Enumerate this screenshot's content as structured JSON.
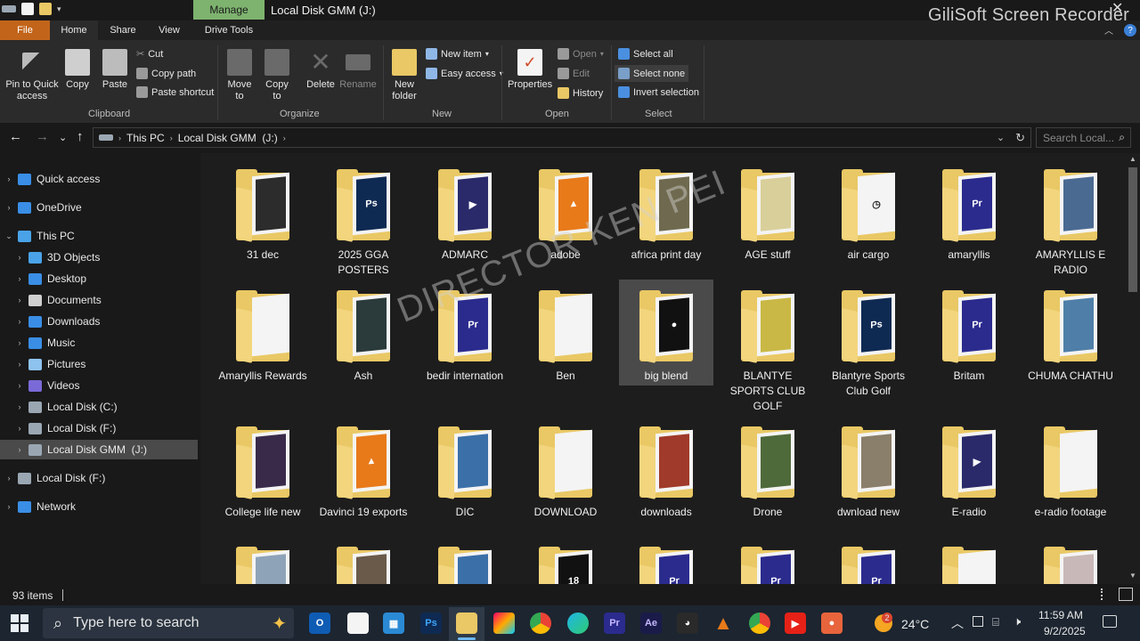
{
  "window": {
    "title": "Local Disk GMM  (J:)",
    "manage_label": "Manage",
    "recorder_watermark": "GiliSoft Screen Recorder"
  },
  "menu_tabs": [
    "File",
    "Home",
    "Share",
    "View",
    "Drive Tools"
  ],
  "ribbon": {
    "clipboard": {
      "pin_label": "Pin to Quick access",
      "copy_label": "Copy",
      "paste_label": "Paste",
      "cut_label": "Cut",
      "copy_path_label": "Copy path",
      "paste_shortcut_label": "Paste shortcut",
      "group_label": "Clipboard"
    },
    "organize": {
      "move_label": "Move to",
      "copy_to_label": "Copy to",
      "delete_label": "Delete",
      "rename_label": "Rename",
      "group_label": "Organize"
    },
    "new": {
      "new_folder_label": "New folder",
      "new_item_label": "New item",
      "easy_access_label": "Easy access",
      "group_label": "New"
    },
    "open": {
      "properties_label": "Properties",
      "open_label": "Open",
      "edit_label": "Edit",
      "history_label": "History",
      "group_label": "Open"
    },
    "select": {
      "select_all_label": "Select all",
      "select_none_label": "Select none",
      "invert_label": "Invert selection",
      "group_label": "Select"
    }
  },
  "address": {
    "crumbs": [
      "This PC",
      "Local Disk GMM  (J:)"
    ],
    "search_placeholder": "Search Local..."
  },
  "nav": [
    {
      "label": "Quick access",
      "icon": "star-icon",
      "color": "#3a8ee6"
    },
    {
      "label": "OneDrive",
      "icon": "cloud-icon",
      "color": "#3a8ee6"
    },
    {
      "label": "This PC",
      "icon": "computer-icon",
      "color": "#4aa3e8"
    },
    {
      "label": "3D Objects",
      "icon": "cube-icon",
      "color": "#4aa3e8"
    },
    {
      "label": "Desktop",
      "icon": "desktop-icon",
      "color": "#3a8ee6"
    },
    {
      "label": "Documents",
      "icon": "document-icon",
      "color": "#cfcfcf"
    },
    {
      "label": "Downloads",
      "icon": "download-icon",
      "color": "#3a8ee6"
    },
    {
      "label": "Music",
      "icon": "music-icon",
      "color": "#3a8ee6"
    },
    {
      "label": "Pictures",
      "icon": "picture-icon",
      "color": "#8fc3ef"
    },
    {
      "label": "Videos",
      "icon": "video-icon",
      "color": "#7a6ad8"
    },
    {
      "label": "Local Disk (C:)",
      "icon": "drive-icon",
      "color": "#9aa7b3"
    },
    {
      "label": "Local Disk (F:)",
      "icon": "drive-icon",
      "color": "#9aa7b3"
    },
    {
      "label": "Local Disk GMM  (J:)",
      "icon": "drive-icon",
      "color": "#9aa7b3"
    },
    {
      "label": "Local Disk (F:)",
      "icon": "drive-icon",
      "color": "#9aa7b3"
    },
    {
      "label": "Network",
      "icon": "network-icon",
      "color": "#3a8ee6"
    }
  ],
  "folders": [
    {
      "label": "31 dec",
      "thumb": "#2c2c2c",
      "text": ""
    },
    {
      "label": "2025 GGA POSTERS",
      "thumb": "#0f2a52",
      "text": "Ps"
    },
    {
      "label": "ADMARC",
      "thumb": "#2a2a6a",
      "text": "▶"
    },
    {
      "label": "adobe",
      "thumb": "#e87a1a",
      "text": "▲"
    },
    {
      "label": "africa print day",
      "thumb": "#6f6a4f",
      "text": ""
    },
    {
      "label": "AGE stuff",
      "thumb": "#d9cf9a",
      "text": ""
    },
    {
      "label": "air cargo",
      "thumb": "#f4f4f4",
      "text": "◷"
    },
    {
      "label": "amaryllis",
      "thumb": "#2b2b8e",
      "text": "Pr"
    },
    {
      "label": "AMARYLLIS E RADIO",
      "thumb": "#4a6a92",
      "text": ""
    },
    {
      "label": "Amaryllis Rewards",
      "thumb": "#f4f4f4",
      "text": ""
    },
    {
      "label": "Ash",
      "thumb": "#2b3b3b",
      "text": ""
    },
    {
      "label": "bedir internation",
      "thumb": "#2b2b8e",
      "text": "Pr"
    },
    {
      "label": "Ben",
      "thumb": "#f4f4f4",
      "text": ""
    },
    {
      "label": "big blend",
      "thumb": "#111111",
      "text": "●"
    },
    {
      "label": "BLANTYE SPORTS CLUB GOLF",
      "thumb": "#c9b845",
      "text": ""
    },
    {
      "label": "Blantyre Sports Club Golf",
      "thumb": "#0f2a52",
      "text": "Ps"
    },
    {
      "label": "Britam",
      "thumb": "#2b2b8e",
      "text": "Pr"
    },
    {
      "label": "CHUMA CHATHU",
      "thumb": "#4f7fa8",
      "text": ""
    },
    {
      "label": "College life new",
      "thumb": "#3a2a4a",
      "text": ""
    },
    {
      "label": "Davinci 19 exports",
      "thumb": "#e87a1a",
      "text": "▲"
    },
    {
      "label": "DIC",
      "thumb": "#3b6fa8",
      "text": ""
    },
    {
      "label": "DOWNLOAD",
      "thumb": "#f4f4f4",
      "text": ""
    },
    {
      "label": "downloads",
      "thumb": "#a03a2a",
      "text": ""
    },
    {
      "label": "Drone",
      "thumb": "#4f6a3a",
      "text": ""
    },
    {
      "label": "dwnload new",
      "thumb": "#8a7f6a",
      "text": ""
    },
    {
      "label": "E-radio",
      "thumb": "#2a2a6a",
      "text": "▶"
    },
    {
      "label": "e-radio footage",
      "thumb": "#f4f4f4",
      "text": ""
    },
    {
      "label": "",
      "thumb": "#8fa3b8",
      "text": ""
    },
    {
      "label": "",
      "thumb": "#6a5a4a",
      "text": ""
    },
    {
      "label": "",
      "thumb": "#3b6fa8",
      "text": ""
    },
    {
      "label": "",
      "thumb": "#111111",
      "text": "18"
    },
    {
      "label": "",
      "thumb": "#2b2b8e",
      "text": "Pr"
    },
    {
      "label": "",
      "thumb": "#2b2b8e",
      "text": "Pr"
    },
    {
      "label": "",
      "thumb": "#2b2b8e",
      "text": "Pr"
    },
    {
      "label": "",
      "thumb": "#f4f4f4",
      "text": ""
    },
    {
      "label": "",
      "thumb": "#c9b8b8",
      "text": ""
    }
  ],
  "watermark": "DIRECTOR KEN PEI",
  "status": {
    "items_count": "93 items"
  },
  "taskbar": {
    "search_placeholder": "Type here to search",
    "temperature": "24°C",
    "weather_badge": "2",
    "time": "11:59 AM",
    "date": "9/2/2025"
  },
  "colors": {
    "accent": "#3a8ee6",
    "file_tab": "#c2651a",
    "manage": "#7db36f",
    "folder": "#e9c865"
  }
}
